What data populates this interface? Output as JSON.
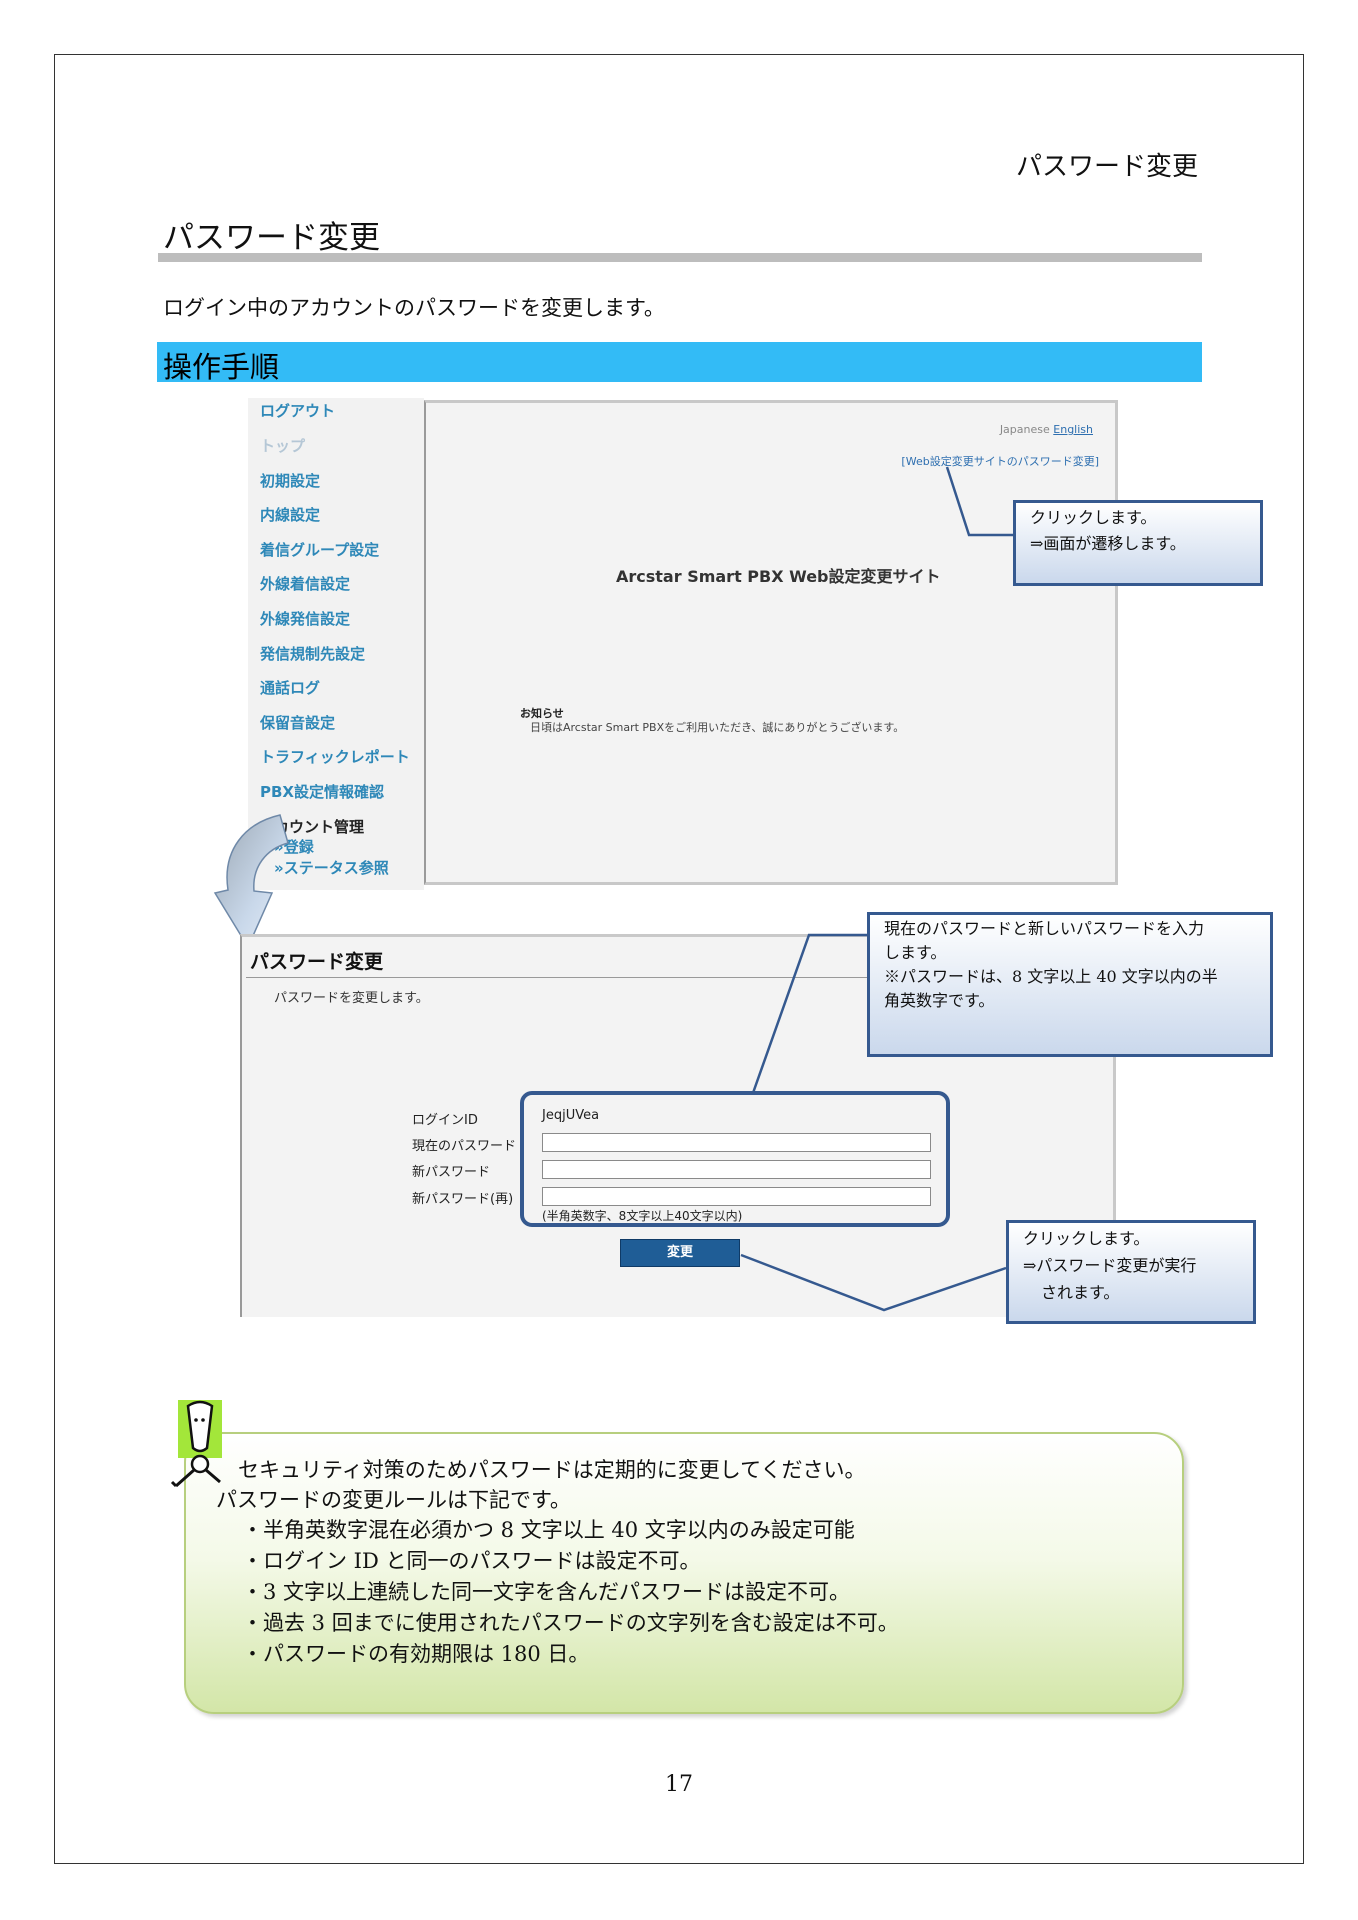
{
  "header": {
    "chapter_title": "パスワード変更"
  },
  "section": {
    "title": "パスワード変更",
    "intro": "ログイン中のアカウントのパスワードを変更します。",
    "step_heading": "操作手順"
  },
  "screenshot1": {
    "sidebar": {
      "items": [
        "ログアウト",
        "トップ",
        "初期設定",
        "内線設定",
        "着信グループ設定",
        "外線着信設定",
        "外線発信設定",
        "発信規制先設定",
        "通話ログ",
        "保留音設定",
        "トラフィックレポート",
        "PBX設定情報確認"
      ],
      "account_heading": "カウント管理",
      "sub_items": [
        "»登録",
        "»ステータス参照"
      ]
    },
    "lang_japanese": "Japanese",
    "lang_english": "English",
    "password_link": "[Web設定変更サイトのパスワード変更]",
    "site_title": "Arcstar Smart PBX Web設定変更サイト",
    "notice_heading": "お知らせ",
    "notice_text": "日頃はArcstar Smart PBXをご利用いただき、誠にありがとうございます。"
  },
  "callouts": {
    "link_click": [
      "クリックします。",
      "⇒画面が遷移します。"
    ],
    "enter_password": [
      "現在のパスワードと新しいパスワードを入力",
      "します。",
      "※パスワードは、8 文字以上 40 文字以内の半",
      "角英数字です。"
    ],
    "change_click": [
      "クリックします。",
      "⇒パスワード変更が実行",
      "されます。"
    ]
  },
  "screenshot2": {
    "heading": "パスワード変更",
    "description": "パスワードを変更します。",
    "labels": {
      "login_id": "ログインID",
      "current_password": "現在のパスワード",
      "new_password": "新パスワード",
      "new_password_confirm": "新パスワード(再)"
    },
    "login_id_value": "JeqjUVea",
    "hint": "(半角英数字、8文字以上40文字以内)",
    "change_button": "変更"
  },
  "tip": {
    "lines": [
      "セキュリティ対策のためパスワードは定期的に変更してください。",
      "パスワードの変更ルールは下記です。",
      "・半角英数字混在必須かつ 8 文字以上 40 文字以内のみ設定可能",
      "・ログイン ID と同一のパスワードは設定不可。",
      "・3 文字以上連続した同一文字を含んだパスワードは設定不可。",
      "・過去 3 回までに使用されたパスワードの文字列を含む設定は不可。",
      "・パスワードの有効期限は 180 日。"
    ]
  },
  "footer": {
    "page_number": "17"
  },
  "colors": {
    "step_bar": "#33bbf6",
    "callout_border": "#35598f",
    "tip_border": "#b7cf7e",
    "link": "#2e88b8"
  }
}
